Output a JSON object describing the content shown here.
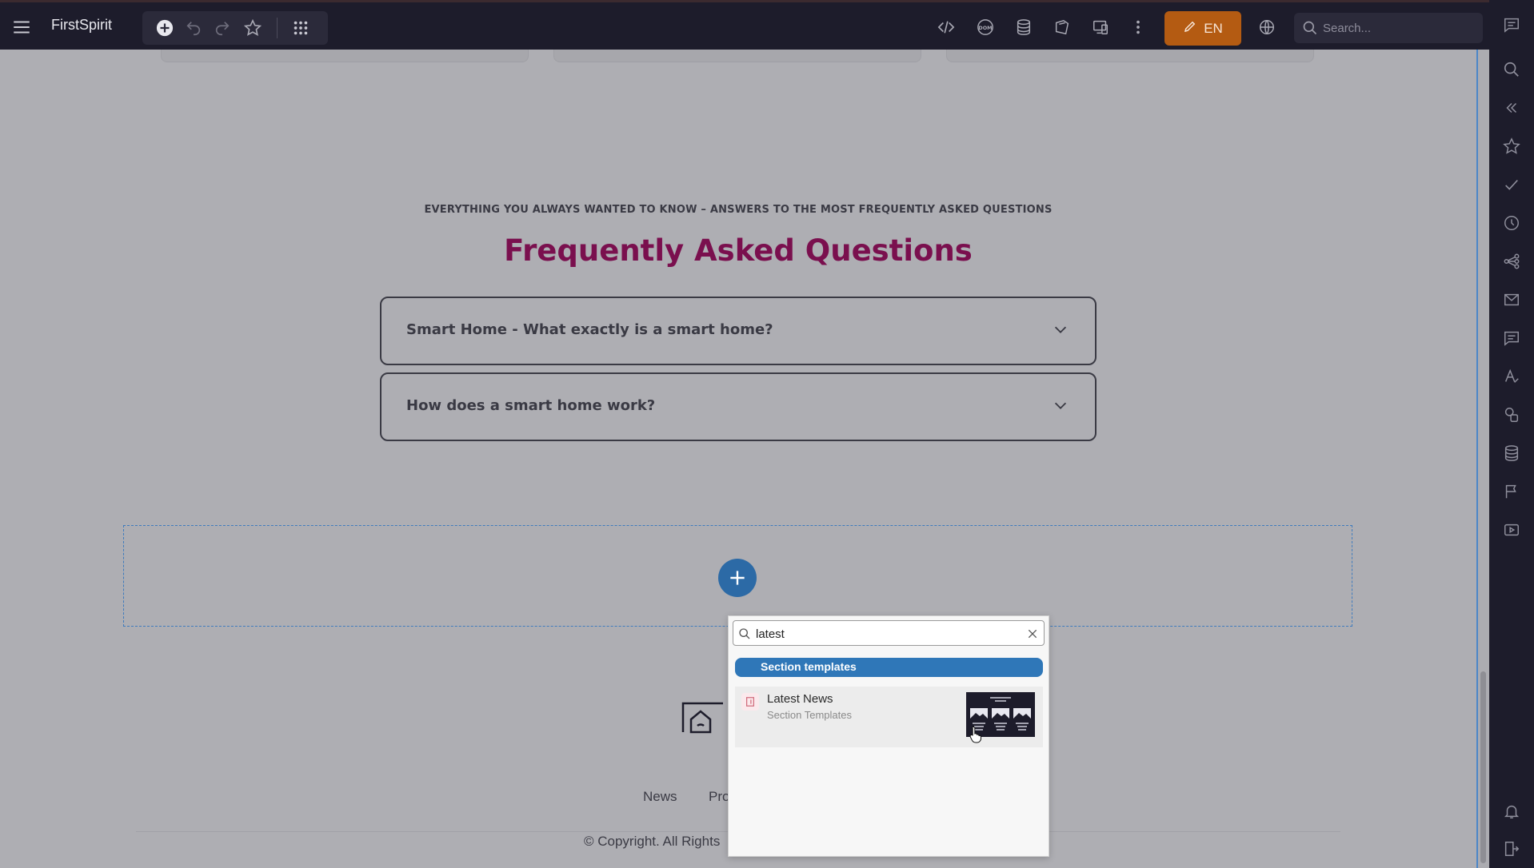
{
  "app": {
    "title": "FirstSpirit"
  },
  "toolbar": {
    "edit_language": "EN",
    "search_placeholder": "Search..."
  },
  "faq": {
    "eyebrow": "EVERYTHING YOU ALWAYS WANTED TO KNOW – ANSWERS TO THE MOST FREQUENTLY ASKED QUESTIONS",
    "title": "Frequently Asked Questions",
    "items": [
      {
        "question": "Smart Home - What exactly is a smart home?"
      },
      {
        "question": "How does a smart home work?"
      }
    ]
  },
  "footer": {
    "links": [
      "News",
      "Pro"
    ],
    "copyright": "© Copyright. All Rights"
  },
  "popup": {
    "search_value": "latest",
    "category": "Section templates",
    "result": {
      "title": "Latest News",
      "subtitle": "Section Templates"
    }
  },
  "colors": {
    "topbar": "#1d1c2b",
    "edit_button": "#b45b12",
    "faq_title": "#7a0f4e",
    "accent_blue": "#2f77b8"
  },
  "icons": {
    "topbar": [
      "menu-icon",
      "add-icon",
      "undo-icon",
      "redo-icon",
      "star-icon",
      "apps-grid-icon",
      "code-icon",
      "dom-icon",
      "database-icon",
      "pages-icon",
      "devices-icon",
      "more-vertical-icon",
      "pencil-icon",
      "globe-icon",
      "search-icon"
    ],
    "sidebar": [
      "comment-icon",
      "search-icon",
      "collapse-icon",
      "star-icon",
      "check-icon",
      "history-icon",
      "structure-icon",
      "mail-icon",
      "chat-icon",
      "text-style-icon",
      "shapes-icon",
      "database-icon",
      "flag-icon",
      "video-icon",
      "bell-icon",
      "logout-icon"
    ]
  }
}
